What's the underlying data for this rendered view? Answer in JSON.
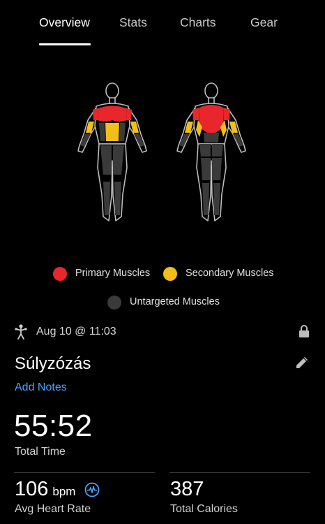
{
  "tabs": [
    {
      "label": "Overview",
      "active": true
    },
    {
      "label": "Stats",
      "active": false
    },
    {
      "label": "Charts",
      "active": false
    },
    {
      "label": "Gear",
      "active": false
    }
  ],
  "muscle_map": {
    "colors": {
      "primary": "#e8262b",
      "secondary": "#f2be1a",
      "untargeted": "#3a3a3a"
    }
  },
  "legend": {
    "primary_label": "Primary Muscles",
    "secondary_label": "Secondary Muscles",
    "untargeted_label": "Untargeted Muscles"
  },
  "activity": {
    "icon": "strength-training-icon",
    "date": "Aug 10 @ 11:03",
    "lock_icon": "lock-icon",
    "title": "Súlyzózás",
    "edit_icon": "pencil-icon",
    "add_notes": "Add Notes"
  },
  "stats": {
    "total_time_value": "55:52",
    "total_time_label": "Total Time",
    "avg_hr_value": "106",
    "avg_hr_unit": "bpm",
    "avg_hr_label": "Avg Heart Rate",
    "hr_icon": "heart-rate-icon",
    "calories_value": "387",
    "calories_label": "Total Calories"
  },
  "accent_color": "#4aa3ff"
}
